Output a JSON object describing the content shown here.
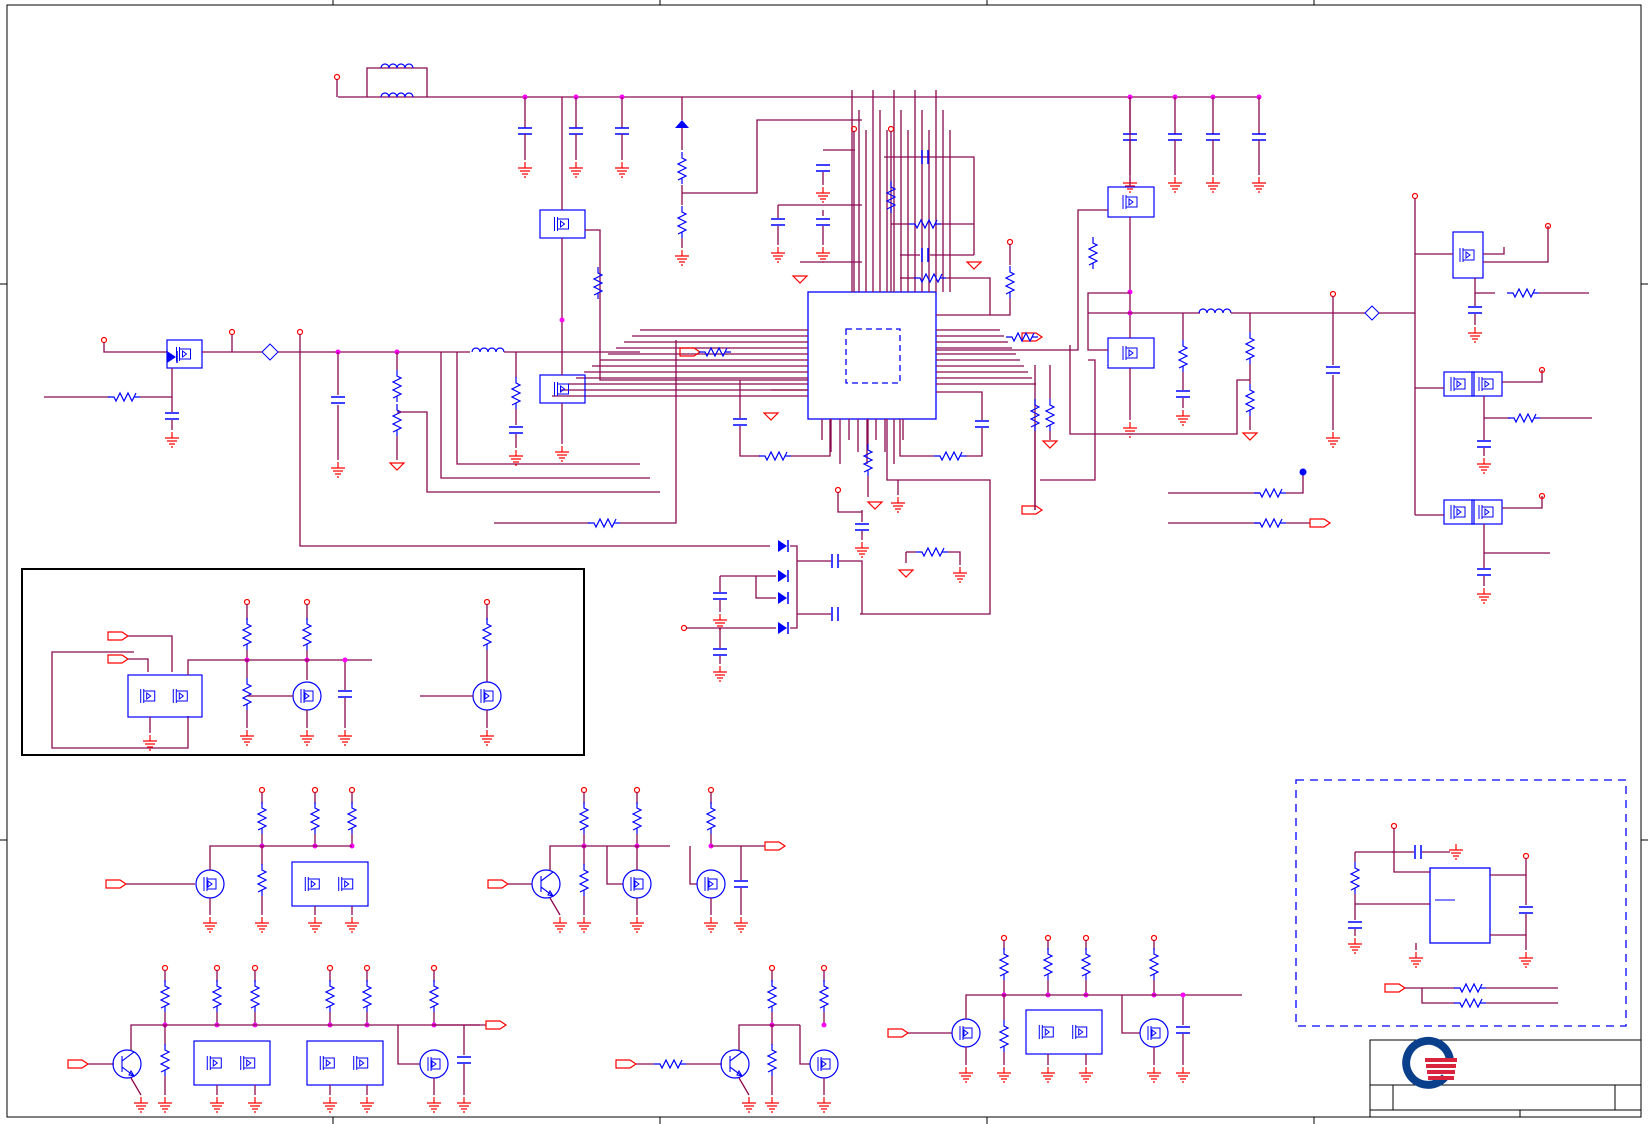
{
  "diagram": {
    "type": "electrical-schematic",
    "colors": {
      "wire": "#8b0a50",
      "component": "#0000ff",
      "pin": "#ff0000",
      "junction": "#ff00ff",
      "frame": "#000000",
      "logo_blue": "#0a3f8c",
      "logo_red": "#d8243c"
    },
    "icons": [
      "resistor-icon",
      "capacitor-icon",
      "ground-icon",
      "mosfet-icon",
      "transistor-icon",
      "diode-icon",
      "inductor-icon",
      "port-icon",
      "power-pin-icon",
      "company-logo"
    ]
  }
}
